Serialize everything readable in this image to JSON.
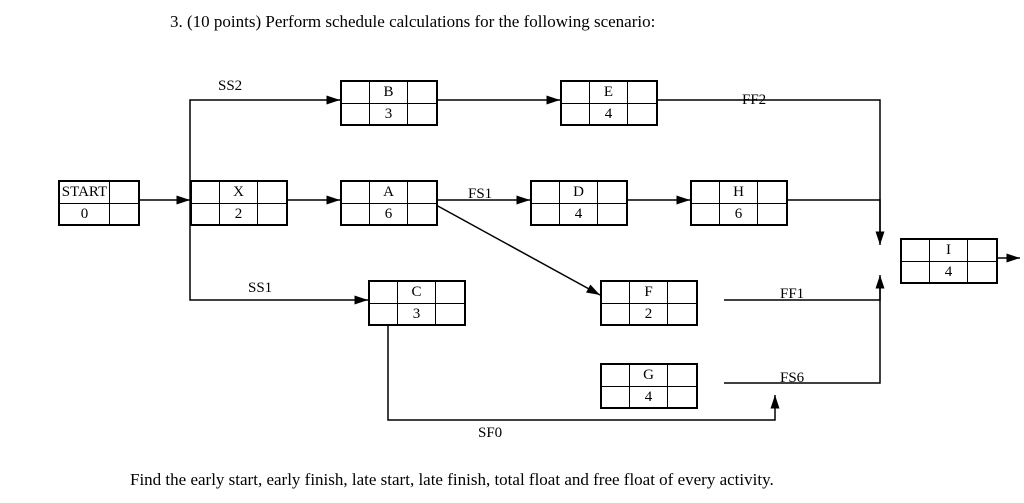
{
  "question": "3.   (10 points) Perform schedule calculations for the following scenario:",
  "footer": "Find the early start, early finish, late start, late finish, total float and free float of every activity.",
  "labels": {
    "ss2": "SS2",
    "ss1": "SS1",
    "fs1": "FS1",
    "ff2": "FF2",
    "ff1": "FF1",
    "fs6": "FS6",
    "sf0": "SF0"
  },
  "nodes": {
    "start": {
      "name": "START",
      "dur": "0"
    },
    "x": {
      "name": "X",
      "dur": "2"
    },
    "b": {
      "name": "B",
      "dur": "3"
    },
    "a": {
      "name": "A",
      "dur": "6"
    },
    "c": {
      "name": "C",
      "dur": "3"
    },
    "e": {
      "name": "E",
      "dur": "4"
    },
    "d": {
      "name": "D",
      "dur": "4"
    },
    "f": {
      "name": "F",
      "dur": "2"
    },
    "g": {
      "name": "G",
      "dur": "4"
    },
    "h": {
      "name": "H",
      "dur": "6"
    },
    "i": {
      "name": "I",
      "dur": "4"
    }
  },
  "chart_data": {
    "type": "diagram",
    "diagram_type": "precedence-network",
    "title": "Schedule network (precedence diagram)",
    "activities": [
      {
        "id": "START",
        "duration": 0
      },
      {
        "id": "X",
        "duration": 2
      },
      {
        "id": "B",
        "duration": 3
      },
      {
        "id": "A",
        "duration": 6
      },
      {
        "id": "C",
        "duration": 3
      },
      {
        "id": "E",
        "duration": 4
      },
      {
        "id": "D",
        "duration": 4
      },
      {
        "id": "F",
        "duration": 2
      },
      {
        "id": "G",
        "duration": 4
      },
      {
        "id": "H",
        "duration": 6
      },
      {
        "id": "I",
        "duration": 4
      }
    ],
    "relationships": [
      {
        "from": "START",
        "to": "X",
        "type": "FS",
        "lag": 0
      },
      {
        "from": "X",
        "to": "B",
        "type": "SS",
        "lag": 2
      },
      {
        "from": "X",
        "to": "A",
        "type": "FS",
        "lag": 0
      },
      {
        "from": "X",
        "to": "C",
        "type": "SS",
        "lag": 1
      },
      {
        "from": "B",
        "to": "E",
        "type": "FS",
        "lag": 0
      },
      {
        "from": "A",
        "to": "D",
        "type": "FS",
        "lag": 1
      },
      {
        "from": "A",
        "to": "F",
        "type": "FS",
        "lag": 0
      },
      {
        "from": "C",
        "to": "G",
        "type": "SF",
        "lag": 0
      },
      {
        "from": "E",
        "to": "I",
        "type": "FF",
        "lag": 2
      },
      {
        "from": "D",
        "to": "H",
        "type": "FS",
        "lag": 0
      },
      {
        "from": "F",
        "to": "I",
        "type": "FF",
        "lag": 1
      },
      {
        "from": "G",
        "to": "I",
        "type": "FS",
        "lag": 6
      },
      {
        "from": "H",
        "to": "I",
        "type": "FS",
        "lag": 0
      }
    ],
    "node_template_cells": [
      "ES",
      "Name",
      "EF",
      "LS",
      "Duration",
      "LF"
    ],
    "to_find": [
      "early start",
      "early finish",
      "late start",
      "late finish",
      "total float",
      "free float"
    ]
  }
}
